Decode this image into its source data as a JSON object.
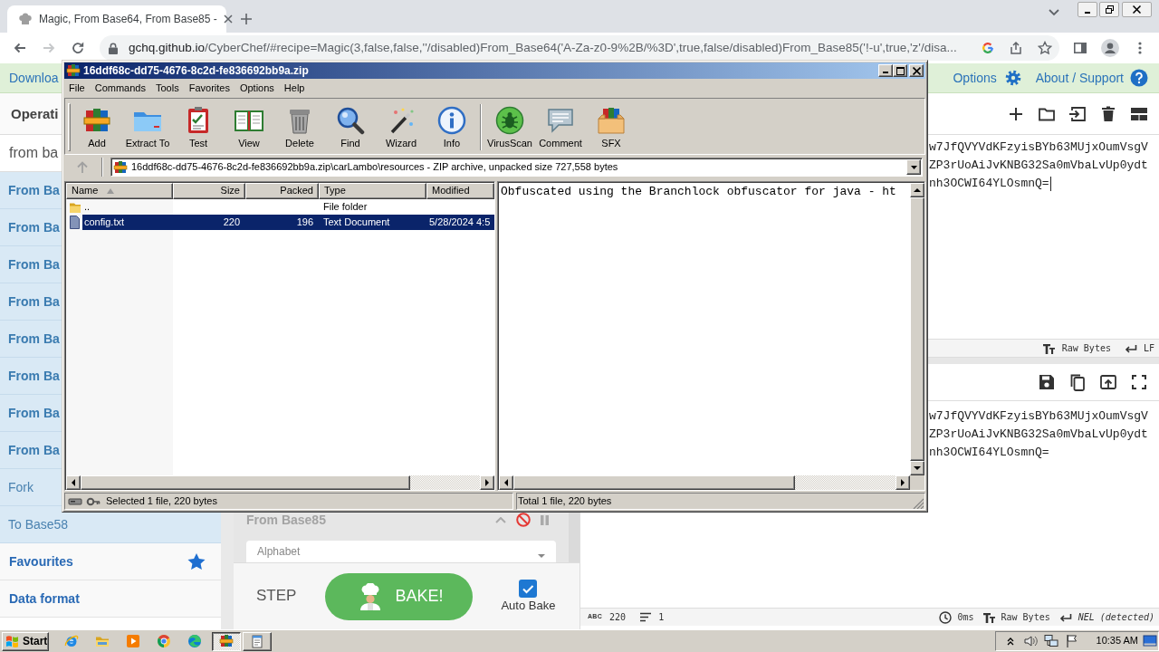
{
  "browser": {
    "tab": {
      "title": "Magic, From Base64, From Base85 -",
      "selected": true
    },
    "nav_buttons": [
      {
        "kind": "back",
        "disabled": false
      },
      {
        "kind": "forward",
        "disabled": true
      },
      {
        "kind": "reload",
        "disabled": false
      }
    ],
    "address": {
      "host": "gchq.github.io",
      "path": "/CyberChef/#recipe=Magic(3,false,false,''/disabled)From_Base64('A-Za-z0-9%2B/%3D',true,false/disabled)From_Base85('!-u',true,'z'/disa..."
    }
  },
  "cyberchef": {
    "banner": {
      "download": "Downloa",
      "options": "Options",
      "about": "About / Support"
    },
    "operations": {
      "title": "Operati",
      "search": "from ba",
      "results": [
        {
          "label": "From Ba",
          "emphasized": true
        },
        {
          "label": "From Ba",
          "emphasized": true
        },
        {
          "label": "From Ba",
          "emphasized": true
        },
        {
          "label": "From Ba",
          "emphasized": true
        },
        {
          "label": "From Ba",
          "emphasized": true
        },
        {
          "label": "From Ba",
          "emphasized": true
        },
        {
          "label": "From Ba",
          "emphasized": true
        },
        {
          "label": "From Ba",
          "emphasized": true
        },
        {
          "label": "Fork",
          "emphasized": false
        },
        {
          "label": "To Base58",
          "emphasized": false
        }
      ],
      "categories": [
        {
          "kind": "favourites",
          "label": "Favourites"
        },
        {
          "kind": "plain",
          "label": "Data format"
        }
      ]
    },
    "recipe": {
      "operations": [
        {
          "title": "From Base85",
          "disabled": true,
          "fields": [
            {
              "label": "Alphabet"
            }
          ]
        }
      ],
      "step": "STEP",
      "bake": "BAKE!",
      "auto_bake": {
        "label": "Auto Bake",
        "checked": true
      }
    },
    "input": {
      "lines": [
        "w7JfQVYVdKFzyisBYb63MUjxOumVsgV",
        "ZP3rUoAiJvKNBG32Sa0mVbaLvUp0ydt",
        "nh3OCWI64YLOsmnQ="
      ],
      "status": {
        "format": "Raw Bytes",
        "eol": "LF"
      }
    },
    "output": {
      "lines": [
        "w7JfQVYVdKFzyisBYb63MUjxOumVsgV",
        "ZP3rUoAiJvKNBG32Sa0mVbaLvUp0ydt",
        "nh3OCWI64YLOsmnQ="
      ],
      "status": {
        "length_label": "ABC",
        "length": "220",
        "lines": "1",
        "time": "0ms",
        "format": "Raw Bytes",
        "eol": "NEL (detected)"
      }
    }
  },
  "winrar": {
    "title": "16ddf68c-dd75-4676-8c2d-fe836692bb9a.zip",
    "menu": [
      "File",
      "Commands",
      "Tools",
      "Favorites",
      "Options",
      "Help"
    ],
    "toolbar": [
      {
        "buttons": [
          "Add",
          "Extract To",
          "Test",
          "View",
          "Delete",
          "Find",
          "Wizard",
          "Info"
        ]
      },
      {
        "buttons": [
          "VirusScan",
          "Comment",
          "SFX"
        ]
      }
    ],
    "up_button": {
      "disabled": true
    },
    "path": "16ddf68c-dd75-4676-8c2d-fe836692bb9a.zip\\carLambo\\resources - ZIP archive, unpacked size 727,558 bytes",
    "columns": [
      {
        "label": "Name",
        "sorted": true
      },
      {
        "label": "Size",
        "sorted": false
      },
      {
        "label": "Packed",
        "sorted": false
      },
      {
        "label": "Type",
        "sorted": false
      },
      {
        "label": "Modified",
        "sorted": false
      }
    ],
    "rows": [
      {
        "kind": "folder",
        "name": "..",
        "type": "File folder",
        "selected": false
      },
      {
        "kind": "file",
        "name": "config.txt",
        "size": "220",
        "packed": "196",
        "type": "Text Document",
        "modified": "5/28/2024 4:5",
        "selected": true
      }
    ],
    "preview": "Obfuscated using the Branchlock obfuscator for java - ht",
    "status": {
      "selection": "Selected 1 file, 220 bytes",
      "total": "Total 1 file, 220 bytes"
    }
  },
  "taskbar": {
    "start": "Start",
    "tasks": [
      {
        "selected": true
      },
      {
        "selected": false
      }
    ],
    "clock": "10:35 AM"
  }
}
